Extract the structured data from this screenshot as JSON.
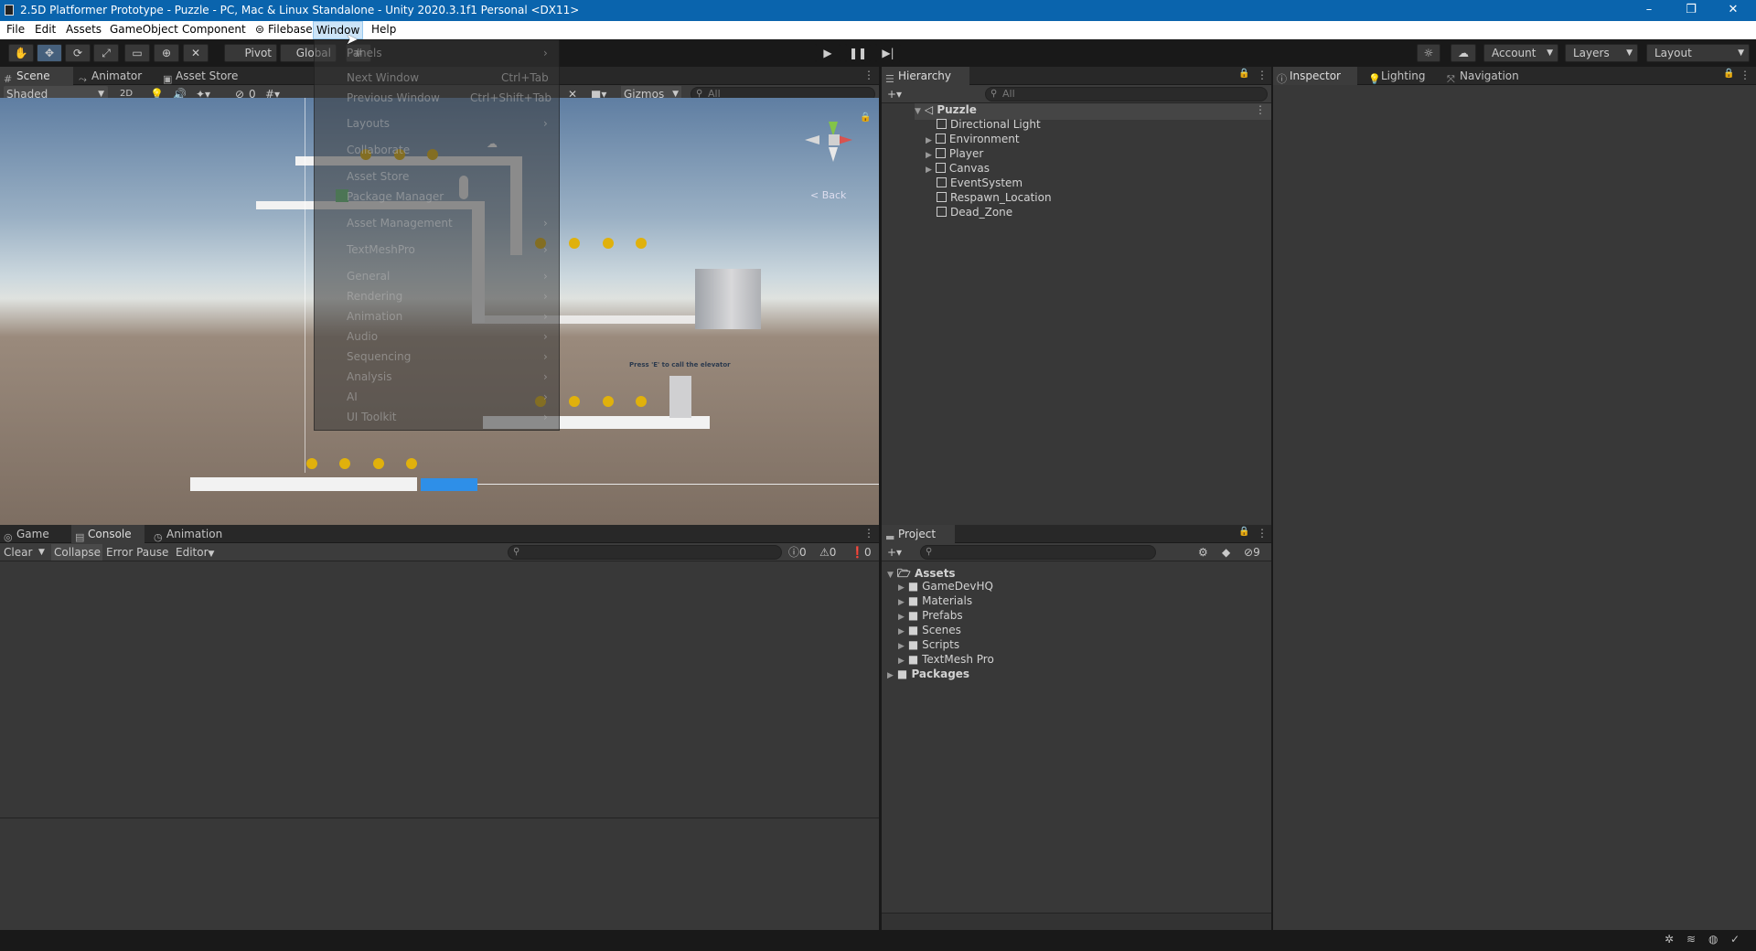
{
  "window": {
    "title": "2.5D Platformer Prototype - Puzzle - PC, Mac & Linux Standalone - Unity 2020.3.1f1 Personal <DX11>",
    "minimize": "–",
    "maximize": "❐",
    "close": "✕"
  },
  "menubar": {
    "file": "File",
    "edit": "Edit",
    "assets": "Assets",
    "gameobject": "GameObject",
    "component": "Component",
    "filebase": "Filebase",
    "window": "Window",
    "help": "Help"
  },
  "toolbar": {
    "pivot": "Pivot",
    "global": "Global",
    "account": "Account",
    "layers": "Layers",
    "layout": "Layout"
  },
  "window_menu": {
    "items": [
      {
        "label": "Panels",
        "shortcut": "",
        "arrow": true
      },
      {
        "label": "Next Window",
        "shortcut": "Ctrl+Tab",
        "arrow": false
      },
      {
        "label": "Previous Window",
        "shortcut": "Ctrl+Shift+Tab",
        "arrow": false
      },
      {
        "label": "Layouts",
        "shortcut": "",
        "arrow": true
      },
      {
        "label": "Collaborate",
        "shortcut": "",
        "arrow": false
      },
      {
        "label": "Asset Store",
        "shortcut": "",
        "arrow": false
      },
      {
        "label": "Package Manager",
        "shortcut": "",
        "arrow": false
      },
      {
        "label": "Asset Management",
        "shortcut": "",
        "arrow": true
      },
      {
        "label": "TextMeshPro",
        "shortcut": "",
        "arrow": true
      },
      {
        "label": "General",
        "shortcut": "",
        "arrow": true
      },
      {
        "label": "Rendering",
        "shortcut": "",
        "arrow": true
      },
      {
        "label": "Animation",
        "shortcut": "",
        "arrow": true
      },
      {
        "label": "Audio",
        "shortcut": "",
        "arrow": true
      },
      {
        "label": "Sequencing",
        "shortcut": "",
        "arrow": true
      },
      {
        "label": "Analysis",
        "shortcut": "",
        "arrow": true
      },
      {
        "label": "AI",
        "shortcut": "",
        "arrow": true
      },
      {
        "label": "UI Toolkit",
        "shortcut": "",
        "arrow": true
      }
    ]
  },
  "scene_panel": {
    "tabs": {
      "scene": "Scene",
      "animator": "Animator",
      "asset_store": "Asset Store"
    },
    "shading": "Shaded",
    "mode_2d": "2D",
    "hidden_count": "0",
    "gizmos": "Gizmos",
    "search_placeholder": "All",
    "gizmo_back": "< Back",
    "prompt_text": "Press 'E' to call the elevator"
  },
  "hierarchy": {
    "tab": "Hierarchy",
    "search_placeholder": "All",
    "scene_name": "Puzzle",
    "objects": [
      {
        "name": "Directional Light",
        "expandable": false
      },
      {
        "name": "Environment",
        "expandable": true
      },
      {
        "name": "Player",
        "expandable": true
      },
      {
        "name": "Canvas",
        "expandable": true
      },
      {
        "name": "EventSystem",
        "expandable": false
      },
      {
        "name": "Respawn_Location",
        "expandable": false
      },
      {
        "name": "Dead_Zone",
        "expandable": false
      }
    ]
  },
  "inspector_tabs": {
    "inspector": "Inspector",
    "lighting": "Lighting",
    "navigation": "Navigation"
  },
  "console_panel": {
    "tabs": {
      "game": "Game",
      "console": "Console",
      "animation": "Animation"
    },
    "clear": "Clear",
    "collapse": "Collapse",
    "error_pause": "Error Pause",
    "editor": "Editor",
    "log_count": "0",
    "warn_count": "0",
    "error_count": "0"
  },
  "project_panel": {
    "tab": "Project",
    "hidden_count": "9",
    "root": "Assets",
    "folders": [
      "GameDevHQ",
      "Materials",
      "Prefabs",
      "Scenes",
      "Scripts",
      "TextMesh Pro"
    ],
    "packages": "Packages"
  }
}
